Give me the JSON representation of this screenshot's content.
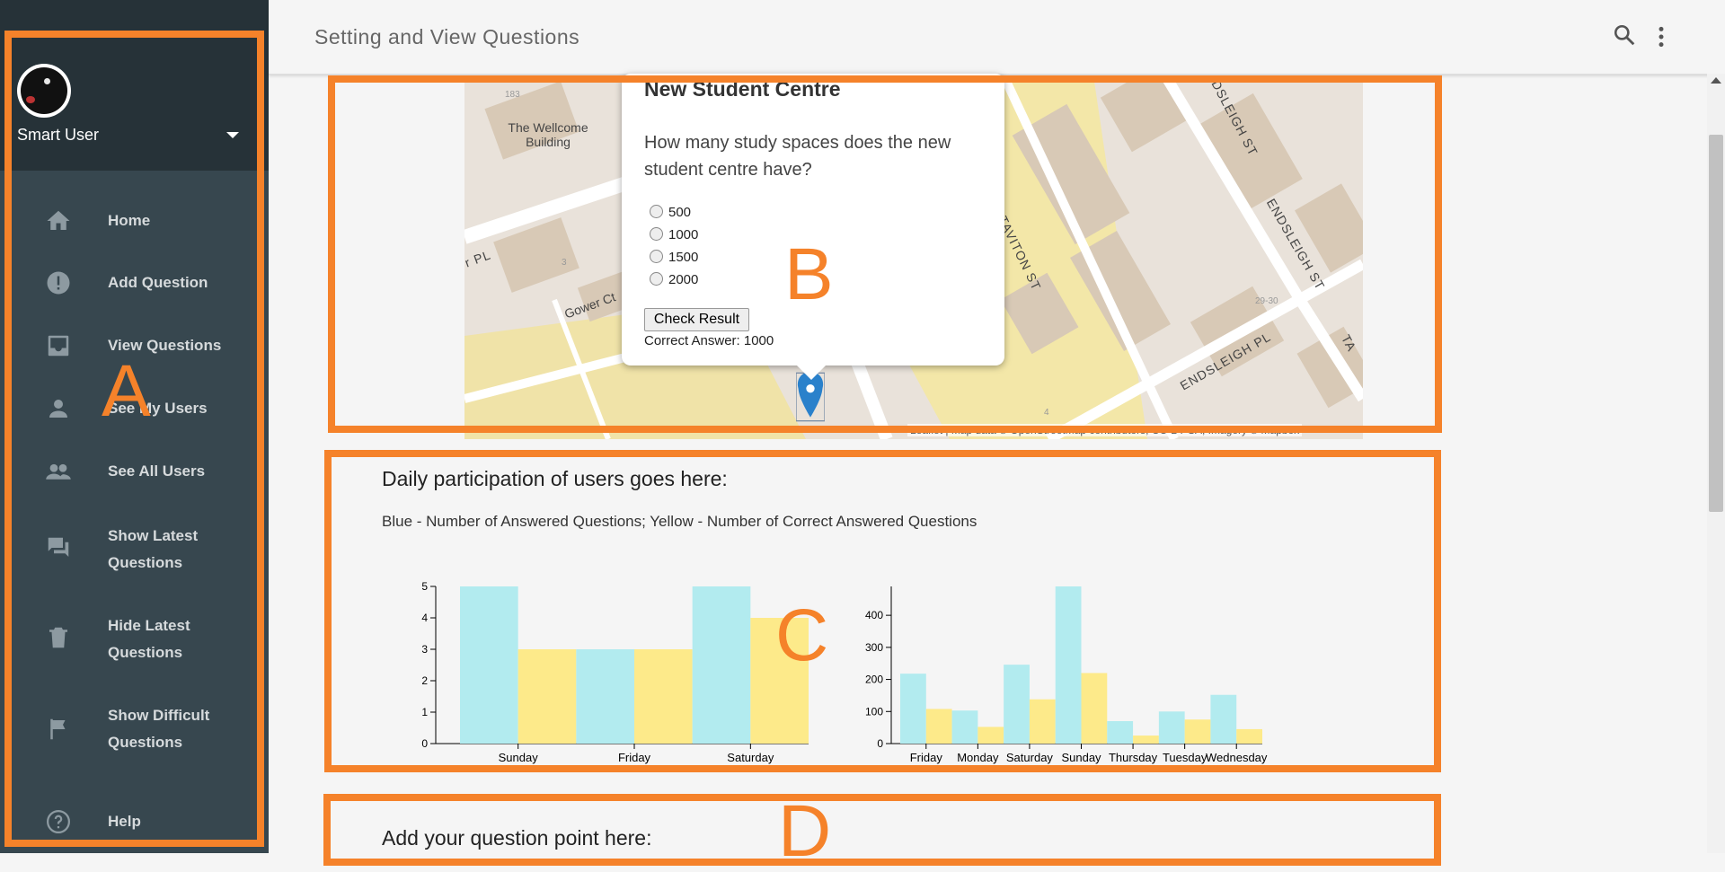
{
  "app": {
    "title": "Setting and View Questions"
  },
  "user": {
    "name": "Smart User"
  },
  "sidebar": {
    "items": [
      {
        "label": "Home",
        "icon": "home-icon"
      },
      {
        "label": "Add Question",
        "icon": "alert-circle-icon"
      },
      {
        "label": "View Questions",
        "icon": "inbox-icon"
      },
      {
        "label": "See My Users",
        "icon": "person-icon"
      },
      {
        "label": "See All Users",
        "icon": "people-icon"
      },
      {
        "label": "Show Latest Questions",
        "icon": "forum-icon"
      },
      {
        "label": "Hide Latest Questions",
        "icon": "trash-icon"
      },
      {
        "label": "Show Difficult Questions",
        "icon": "flag-icon"
      },
      {
        "label": "Help",
        "icon": "help-circle-icon"
      }
    ]
  },
  "annotations": {
    "a": "A",
    "b": "B",
    "c": "C",
    "d": "D"
  },
  "map": {
    "labels": {
      "wellcome": "The Wellcome Building",
      "gower": "Gower Ct",
      "pl": "r PL",
      "tavition": "TAVITON ST",
      "endsleigh_st": "ENDSLEIGH ST",
      "endsleigh_st2": "ENDSLEIGH ST",
      "endsleigh_pl": "ENDSLEIGH PL",
      "num183": "183",
      "num3": "3",
      "num2930": "29-30",
      "num4": "4",
      "ta": "TA"
    },
    "attribution": "Leaflet | Map data © OpenStreetMap contributors, CC-BY-SA, Imagery © Mapbox",
    "popup": {
      "title": "New Student Centre",
      "question": "How many study spaces does the new student centre have?",
      "options": [
        "500",
        "1000",
        "1500",
        "2000"
      ],
      "button": "Check Result",
      "answer": "Correct Answer: 1000"
    }
  },
  "participation": {
    "title": "Daily participation of users goes here:",
    "legend": "Blue - Number of Answered Questions; Yellow - Number of Correct Answered Questions"
  },
  "add_point": {
    "title": "Add your question point here:"
  },
  "colors": {
    "blue": "#b2ebef",
    "yellow": "#fdea8a",
    "annotation": "#f5822a",
    "sidebar": "#37474f"
  },
  "chart_data": [
    {
      "type": "bar",
      "categories": [
        "Sunday",
        "Friday",
        "Saturday"
      ],
      "series": [
        {
          "values": [
            5,
            3,
            5
          ]
        },
        {
          "values": [
            3,
            3,
            4
          ]
        }
      ],
      "ylim": [
        0,
        5
      ],
      "yticks": [
        0,
        1,
        2,
        3,
        4,
        5
      ]
    },
    {
      "type": "bar",
      "categories": [
        "Friday",
        "Monday",
        "Saturday",
        "Sunday",
        "Thursday",
        "Tuesday",
        "Wednesday"
      ],
      "series": [
        {
          "values": [
            218,
            103,
            246,
            490,
            70,
            100,
            152
          ]
        },
        {
          "values": [
            108,
            52,
            138,
            220,
            25,
            75,
            45
          ]
        }
      ],
      "ylim": [
        0,
        490
      ],
      "yticks": [
        0,
        100,
        200,
        300,
        400
      ]
    }
  ]
}
